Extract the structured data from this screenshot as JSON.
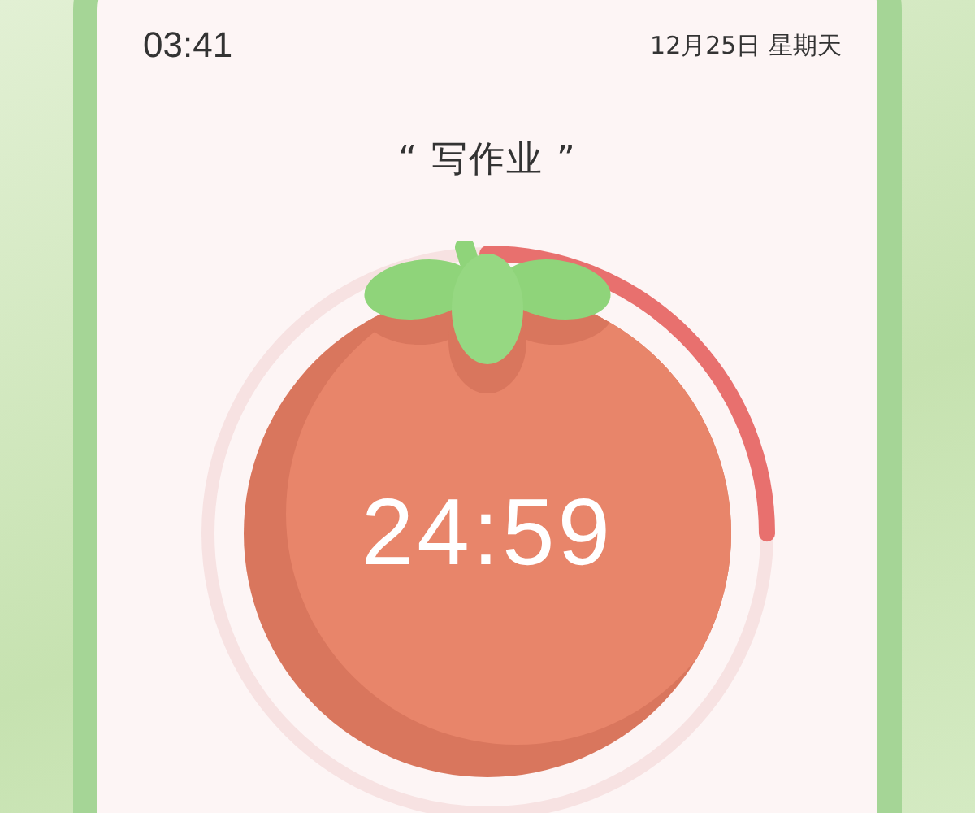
{
  "status_bar": {
    "time": "03:41",
    "date": "12月25日 星期天"
  },
  "task_title": "“ 写作业 ”",
  "timer": {
    "reading": "24:59",
    "level": 0.25
  }
}
